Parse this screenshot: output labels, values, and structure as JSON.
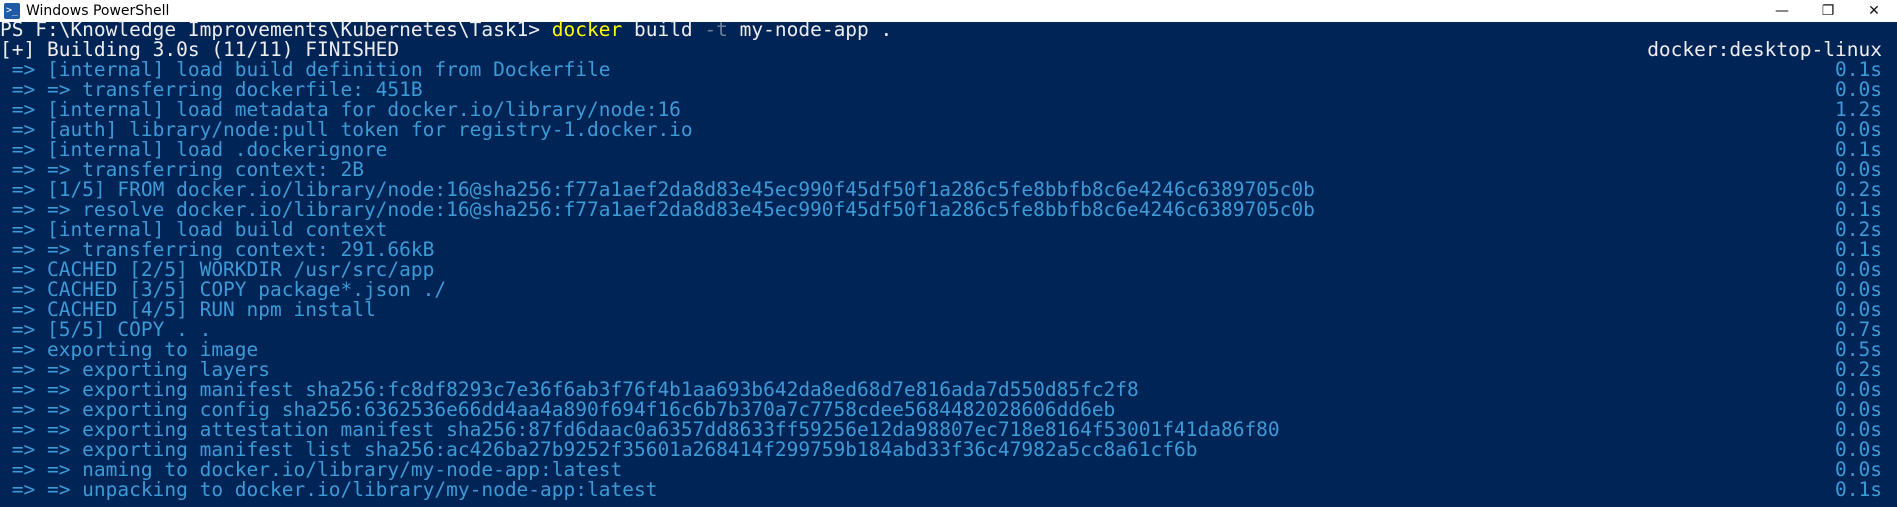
{
  "window": {
    "title": "Windows PowerShell",
    "icon": "powershell-icon",
    "controls": {
      "minimize": "—",
      "maximize": "❐",
      "close": "✕"
    }
  },
  "prompt": {
    "path": "PS F:\\Knowledge Improvements\\Kubernetes\\Task1> ",
    "command": "docker",
    "arg1": " build ",
    "flag": "-t",
    "arg2": " my-node-app ."
  },
  "status": {
    "text": "[+] Building 3.0s (11/11) FINISHED",
    "context": "docker:desktop-linux"
  },
  "steps": [
    {
      "text": " => [internal] load build definition from Dockerfile",
      "time": "0.1s"
    },
    {
      "text": " => => transferring dockerfile: 451B",
      "time": "0.0s"
    },
    {
      "text": " => [internal] load metadata for docker.io/library/node:16",
      "time": "1.2s"
    },
    {
      "text": " => [auth] library/node:pull token for registry-1.docker.io",
      "time": "0.0s"
    },
    {
      "text": " => [internal] load .dockerignore",
      "time": "0.1s"
    },
    {
      "text": " => => transferring context: 2B",
      "time": "0.0s"
    },
    {
      "text": " => [1/5] FROM docker.io/library/node:16@sha256:f77a1aef2da8d83e45ec990f45df50f1a286c5fe8bbfb8c6e4246c6389705c0b",
      "time": "0.2s"
    },
    {
      "text": " => => resolve docker.io/library/node:16@sha256:f77a1aef2da8d83e45ec990f45df50f1a286c5fe8bbfb8c6e4246c6389705c0b",
      "time": "0.1s"
    },
    {
      "text": " => [internal] load build context",
      "time": "0.2s"
    },
    {
      "text": " => => transferring context: 291.66kB",
      "time": "0.1s"
    },
    {
      "text": " => CACHED [2/5] WORKDIR /usr/src/app",
      "time": "0.0s"
    },
    {
      "text": " => CACHED [3/5] COPY package*.json ./",
      "time": "0.0s"
    },
    {
      "text": " => CACHED [4/5] RUN npm install",
      "time": "0.0s"
    },
    {
      "text": " => [5/5] COPY . .",
      "time": "0.7s"
    },
    {
      "text": " => exporting to image",
      "time": "0.5s"
    },
    {
      "text": " => => exporting layers",
      "time": "0.2s"
    },
    {
      "text": " => => exporting manifest sha256:fc8df8293c7e36f6ab3f76f4b1aa693b642da8ed68d7e816ada7d550d85fc2f8",
      "time": "0.0s"
    },
    {
      "text": " => => exporting config sha256:6362536e66dd4aa4a890f694f16c6b7b370a7c7758cdee5684482028606dd6eb",
      "time": "0.0s"
    },
    {
      "text": " => => exporting attestation manifest sha256:87fd6daac0a6357dd8633ff59256e12da98807ec718e8164f53001f41da86f80",
      "time": "0.0s"
    },
    {
      "text": " => => exporting manifest list sha256:ac426ba27b9252f35601a268414f299759b184abd33f36c47982a5cc8a61cf6b",
      "time": "0.0s"
    },
    {
      "text": " => => naming to docker.io/library/my-node-app:latest",
      "time": "0.0s"
    },
    {
      "text": " => => unpacking to docker.io/library/my-node-app:latest",
      "time": "0.1s"
    }
  ],
  "colors": {
    "background": "#012456",
    "step_text": "#3d9ad6",
    "command": "#ffff00",
    "plain": "#eeedf0"
  }
}
